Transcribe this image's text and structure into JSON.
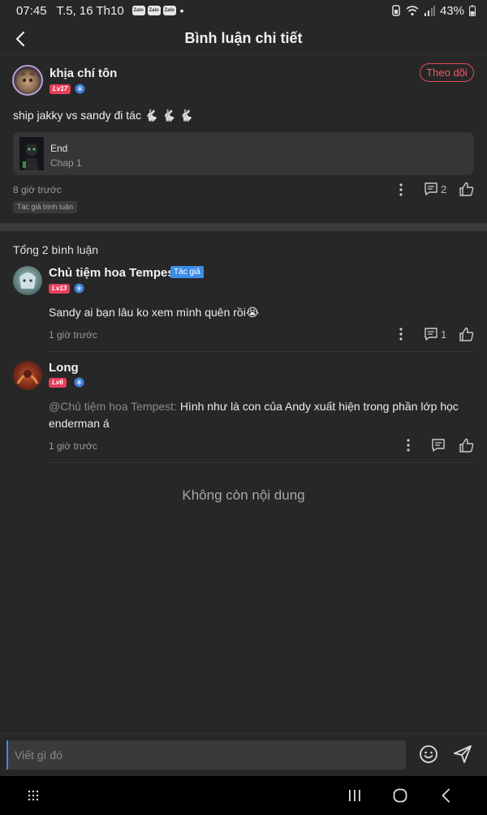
{
  "status_bar": {
    "time": "07:45",
    "date": "T.5, 16 Th10",
    "notif_icons": [
      "Zalo",
      "Zalo",
      "Zalo"
    ],
    "battery": "43%"
  },
  "header": {
    "title": "Bình luận chi tiết"
  },
  "post": {
    "username": "khịa chí tôn",
    "level": "Lv17",
    "follow_label": "Theo dõi",
    "text": "ship jakky vs sandy đi tác 🐇 🐇 🐇",
    "card": {
      "title": "End",
      "subtitle": "Chap 1"
    },
    "time": "8 giờ trước",
    "comment_count": "2",
    "author_tag": "Tác giả bình luận"
  },
  "total_label": "Tổng 2 bình luận",
  "comments": [
    {
      "name": "Chủ tiệm hoa Tempest",
      "tag": "Tác giả",
      "level": "Lv13",
      "text": "Sandy ai bạn lâu ko xem mình quên rồi😭",
      "time": "1 giờ trước",
      "reply_count": "1"
    },
    {
      "name": "Long",
      "level": "Lv6",
      "mention": "@Chủ tiệm hoa Tempest:",
      "text": "Hình như là con của Andy xuất hiện trong phần lớp học enderman á",
      "time": "1 giờ trước"
    }
  ],
  "end_text": "Không còn nội dung",
  "input": {
    "placeholder": "Viết gì đó"
  },
  "colors": {
    "accent": "#e83f5b",
    "tag_blue": "#3c8ce8",
    "background": "#272727"
  }
}
